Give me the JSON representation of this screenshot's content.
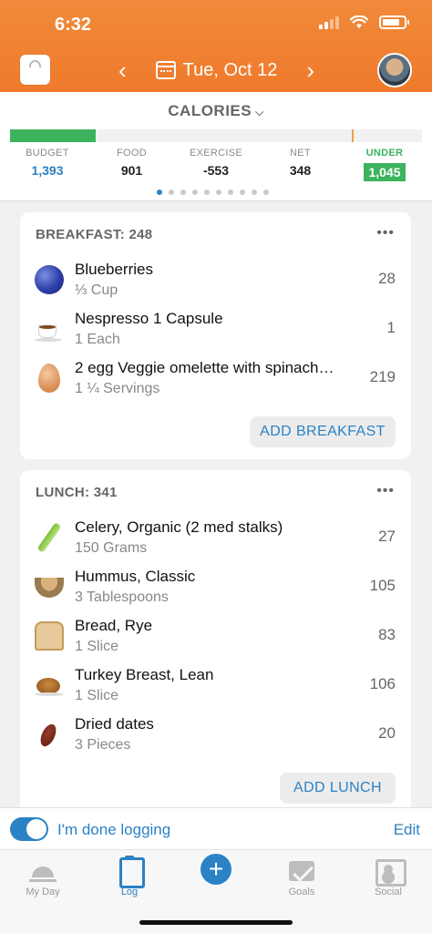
{
  "status": {
    "time": "6:32"
  },
  "header": {
    "date": "Tue, Oct 12",
    "prev": "‹",
    "next": "›"
  },
  "summary": {
    "title": "CALORIES",
    "stats": [
      {
        "label": "BUDGET",
        "value": "1,393"
      },
      {
        "label": "FOOD",
        "value": "901"
      },
      {
        "label": "EXERCISE",
        "value": "-553"
      },
      {
        "label": "NET",
        "value": "348"
      },
      {
        "label": "UNDER",
        "value": "1,045"
      }
    ],
    "progress_fraction": 0.25,
    "page_dots": 10,
    "active_dot": 0
  },
  "meals": [
    {
      "header": "BREAKFAST: 248",
      "add_label": "ADD BREAKFAST",
      "items": [
        {
          "name": "Blueberries",
          "amount": "⅓ Cup",
          "calories": "28",
          "icon": "blueberry-icon"
        },
        {
          "name": "Nespresso 1 Capsule",
          "amount": "1 Each",
          "calories": "1",
          "icon": "coffee-icon"
        },
        {
          "name": "2 egg Veggie omelette with spinach…",
          "amount": "1 ¼ Servings",
          "calories": "219",
          "icon": "egg-icon"
        }
      ]
    },
    {
      "header": "LUNCH: 341",
      "add_label": "ADD LUNCH",
      "items": [
        {
          "name": "Celery, Organic (2 med stalks)",
          "amount": "150 Grams",
          "calories": "27",
          "icon": "celery-icon"
        },
        {
          "name": "Hummus, Classic",
          "amount": "3 Tablespoons",
          "calories": "105",
          "icon": "hummus-icon"
        },
        {
          "name": "Bread, Rye",
          "amount": "1 Slice",
          "calories": "83",
          "icon": "bread-icon"
        },
        {
          "name": "Turkey Breast, Lean",
          "amount": "1 Slice",
          "calories": "106",
          "icon": "turkey-icon"
        },
        {
          "name": "Dried dates",
          "amount": "3 Pieces",
          "calories": "20",
          "icon": "dates-icon"
        }
      ]
    }
  ],
  "done_bar": {
    "label": "I'm done logging",
    "edit": "Edit",
    "toggle_on": true
  },
  "tabs": [
    {
      "label": "My Day"
    },
    {
      "label": "Log"
    },
    {
      "label": "Goals"
    },
    {
      "label": "Social"
    }
  ],
  "colors": {
    "header": "#f07a2c",
    "accent": "#2b82c5",
    "green": "#3cb35c"
  }
}
